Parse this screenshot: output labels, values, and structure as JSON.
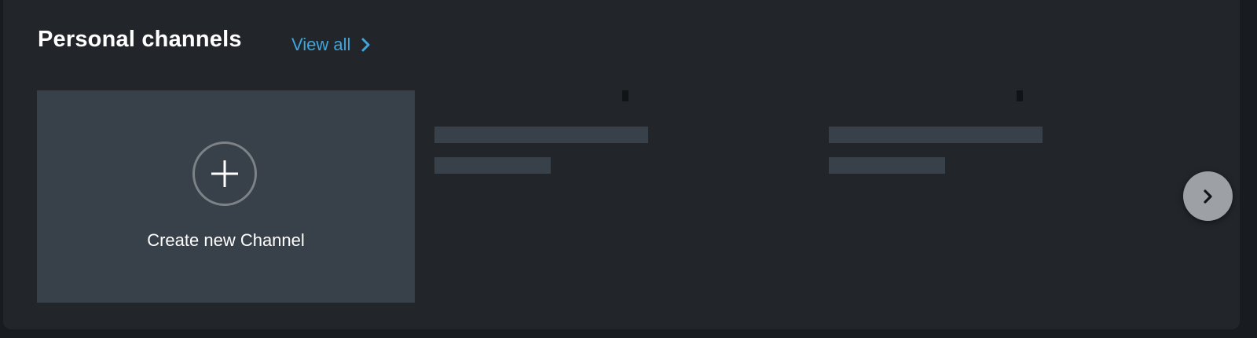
{
  "section": {
    "title": "Personal channels",
    "view_all_label": "View all"
  },
  "create_card": {
    "label": "Create new Channel"
  },
  "icons": {
    "view_all": "chevron-right-icon",
    "create": "plus-icon",
    "next": "chevron-right-icon"
  },
  "colors": {
    "panel_bg": "#22262b",
    "card_bg": "#38414a",
    "link": "#3ea6dd",
    "text": "#ffffff",
    "next_button": "#9da1a5"
  }
}
